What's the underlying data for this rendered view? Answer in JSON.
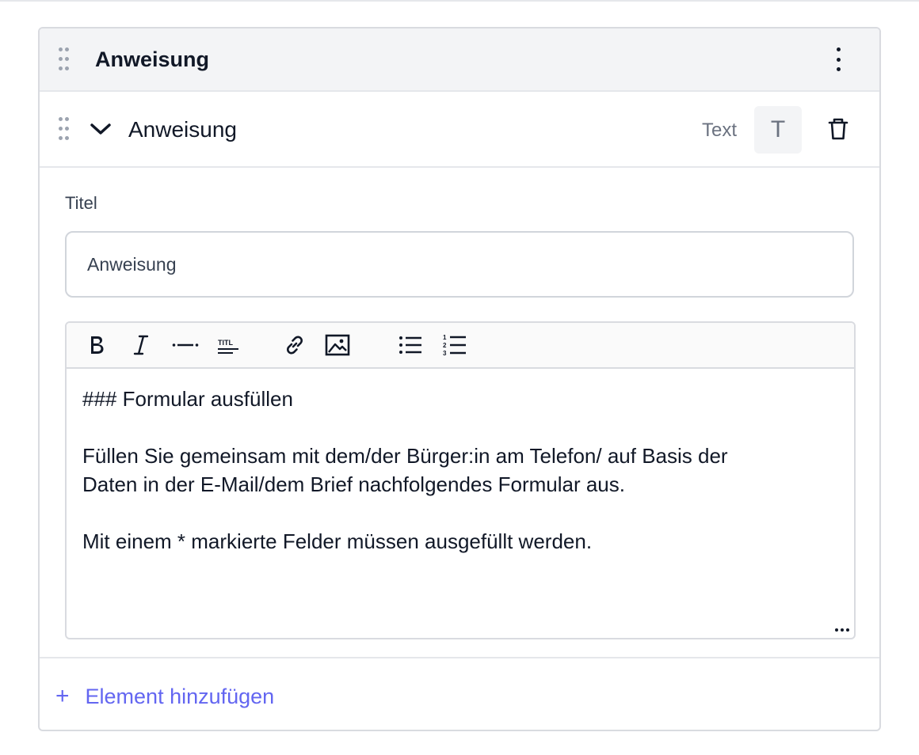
{
  "section": {
    "title": "Anweisung"
  },
  "item": {
    "title": "Anweisung",
    "type_label": "Text",
    "type_badge": "T"
  },
  "form": {
    "title_label": "Titel",
    "title_value": "Anweisung"
  },
  "editor": {
    "toolbar": [
      "bold",
      "italic",
      "horizontal-rule",
      "heading",
      "link",
      "image",
      "bullet-list",
      "numbered-list"
    ],
    "lines": [
      "### Formular ausfüllen",
      "Füllen Sie gemeinsam mit dem/der Bürger:in am Telefon/ auf Basis der",
      "Daten in der E-Mail/dem Brief nachfolgendes Formular aus.",
      "Mit einem * markierte Felder müssen ausgefüllt werden."
    ]
  },
  "footer": {
    "add_label": "Element hinzufügen"
  },
  "colors": {
    "accent": "#6366f1",
    "header_bg": "#f3f4f6",
    "border": "#d9dbe0"
  }
}
